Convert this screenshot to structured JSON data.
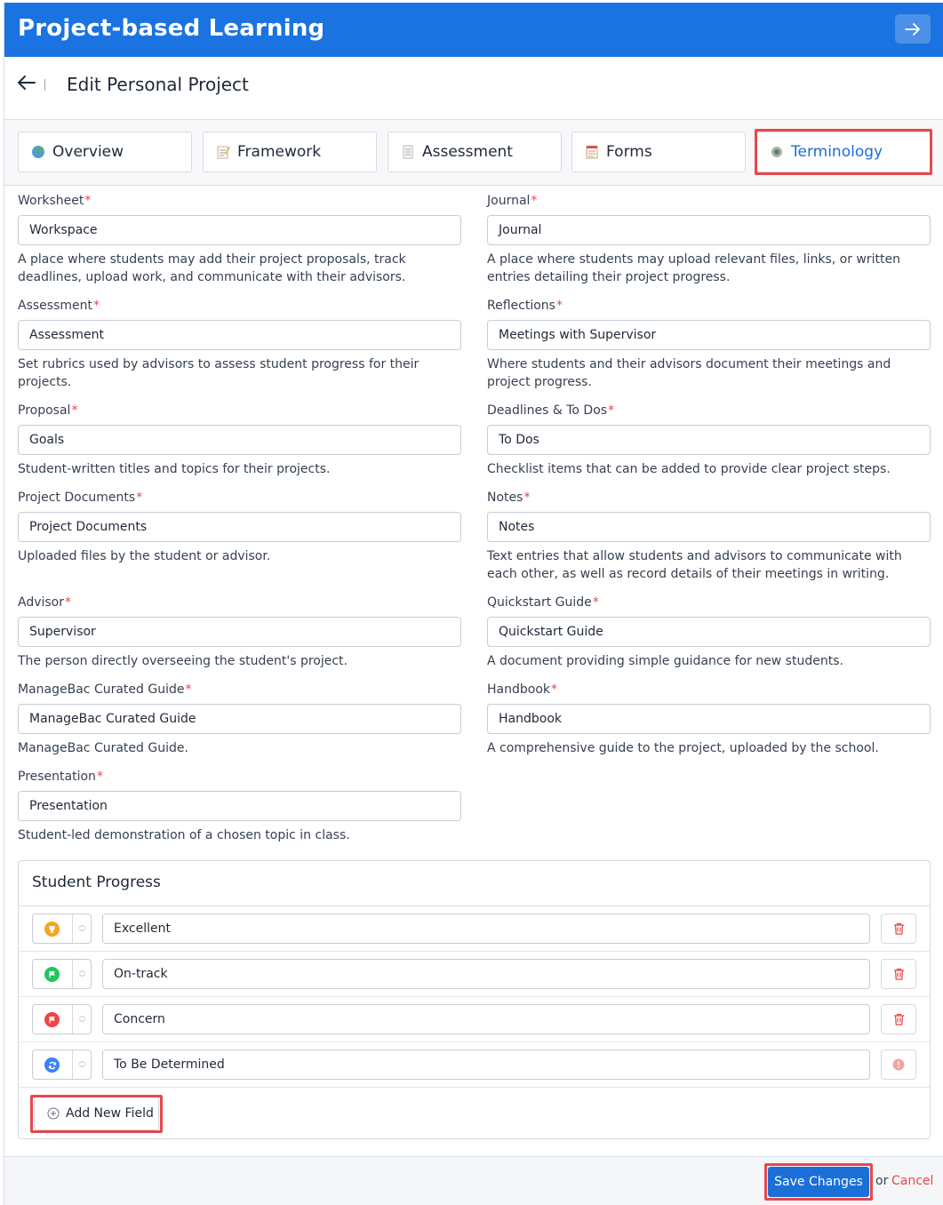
{
  "header": {
    "title": "Project-based Learning",
    "close_icon": "arrow-right-icon"
  },
  "subheader": {
    "back_icon": "arrow-left-icon",
    "title": "Edit Personal Project"
  },
  "tabs": [
    {
      "label": "Overview",
      "icon": "globe-icon"
    },
    {
      "label": "Framework",
      "icon": "memo-icon"
    },
    {
      "label": "Assessment",
      "icon": "document-icon"
    },
    {
      "label": "Forms",
      "icon": "notepad-icon"
    },
    {
      "label": "Terminology",
      "icon": "dot-icon",
      "active": true
    }
  ],
  "required_mark": "*",
  "fields_left": [
    {
      "label": "Worksheet",
      "value": "Workspace",
      "desc": "A place where students may add their project proposals, track deadlines, upload work, and communicate with their advisors."
    },
    {
      "label": "Assessment",
      "value": "Assessment",
      "desc": "Set rubrics used by advisors to assess student progress for their projects."
    },
    {
      "label": "Proposal",
      "value": "Goals",
      "desc": "Student-written titles and topics for their projects."
    },
    {
      "label": "Project Documents",
      "value": "Project Documents",
      "desc": "Uploaded files by the student or advisor."
    },
    {
      "label": "Advisor",
      "value": "Supervisor",
      "desc": "The person directly overseeing the student's project."
    },
    {
      "label": "ManageBac Curated Guide",
      "value": "ManageBac Curated Guide",
      "desc": "ManageBac Curated Guide."
    },
    {
      "label": "Presentation",
      "value": "Presentation",
      "desc": "Student-led demonstration of a chosen topic in class."
    }
  ],
  "fields_right": [
    {
      "label": "Journal",
      "value": "Journal",
      "desc": "A place where students may upload relevant files, links, or written entries detailing their project progress."
    },
    {
      "label": "Reflections",
      "value": "Meetings with Supervisor",
      "desc": "Where students and their advisors document their meetings and project progress."
    },
    {
      "label": "Deadlines & To Dos",
      "value": "To Dos",
      "desc": "Checklist items that can be added to provide clear project steps."
    },
    {
      "label": "Notes",
      "value": "Notes",
      "desc": "Text entries that allow students and advisors to communicate with each other, as well as record details of their meetings in writing."
    },
    {
      "label": "Quickstart Guide",
      "value": "Quickstart Guide",
      "desc": "A document providing simple guidance for new students."
    },
    {
      "label": "Handbook",
      "value": "Handbook",
      "desc": "A comprehensive guide to the project, uploaded by the school."
    }
  ],
  "progress": {
    "title": "Student Progress",
    "rows": [
      {
        "value": "Excellent",
        "icon": "trophy-icon",
        "color": "#f5a623"
      },
      {
        "value": "On-track",
        "icon": "flag-icon",
        "color": "#22c55e"
      },
      {
        "value": "Concern",
        "icon": "flag-icon",
        "color": "#ef4444"
      },
      {
        "value": "To Be Determined",
        "icon": "refresh-icon",
        "color": "#3b82f6"
      }
    ],
    "add_label": "Add New Field"
  },
  "footer": {
    "save_label": "Save Changes",
    "or_text": "or",
    "cancel_label": "Cancel"
  },
  "colors": {
    "brand": "#1a73e0",
    "highlight": "#e5484d",
    "link": "#1a6fd8"
  }
}
